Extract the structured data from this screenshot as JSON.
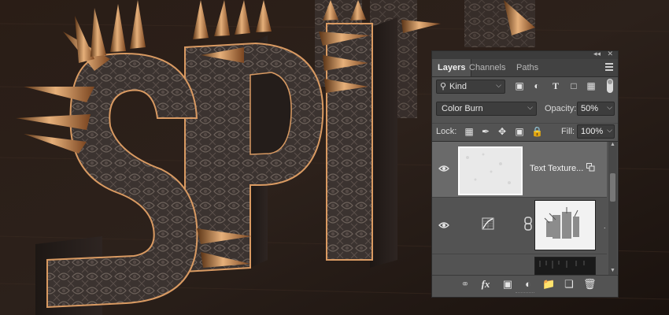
{
  "panel": {
    "tabs": [
      "Layers",
      "Channels",
      "Paths"
    ],
    "active_tab": "Layers",
    "filter": {
      "kind_label": "Kind"
    },
    "blend_mode": "Color Burn",
    "opacity_label": "Opacity:",
    "opacity_value": "50%",
    "lock_label": "Lock:",
    "fill_label": "Fill:",
    "fill_value": "100%",
    "layers": [
      {
        "name": "Text Texture...",
        "visible": true,
        "selected": true,
        "smart_object": true
      },
      {
        "name": "",
        "visible": true,
        "selected": false,
        "adjustment": "curves"
      },
      {
        "name": "",
        "visible": false,
        "selected": false
      }
    ]
  },
  "colors": {
    "panel_bg": "#535353",
    "selected_row": "#6a6a6a",
    "tab_bar": "#424242"
  },
  "icons": {
    "filter": [
      "image-filter-icon",
      "adjustment-filter-icon",
      "type-filter-icon",
      "shape-filter-icon",
      "smart-object-filter-icon"
    ],
    "lock": [
      "lock-transparent-pixels-icon",
      "lock-image-pixels-icon",
      "lock-position-icon",
      "lock-artboard-icon",
      "lock-all-icon"
    ],
    "bottom": [
      "link-layers-icon",
      "fx-icon",
      "add-mask-icon",
      "adjustment-layer-icon",
      "new-group-icon",
      "new-layer-icon",
      "delete-layer-icon"
    ]
  }
}
